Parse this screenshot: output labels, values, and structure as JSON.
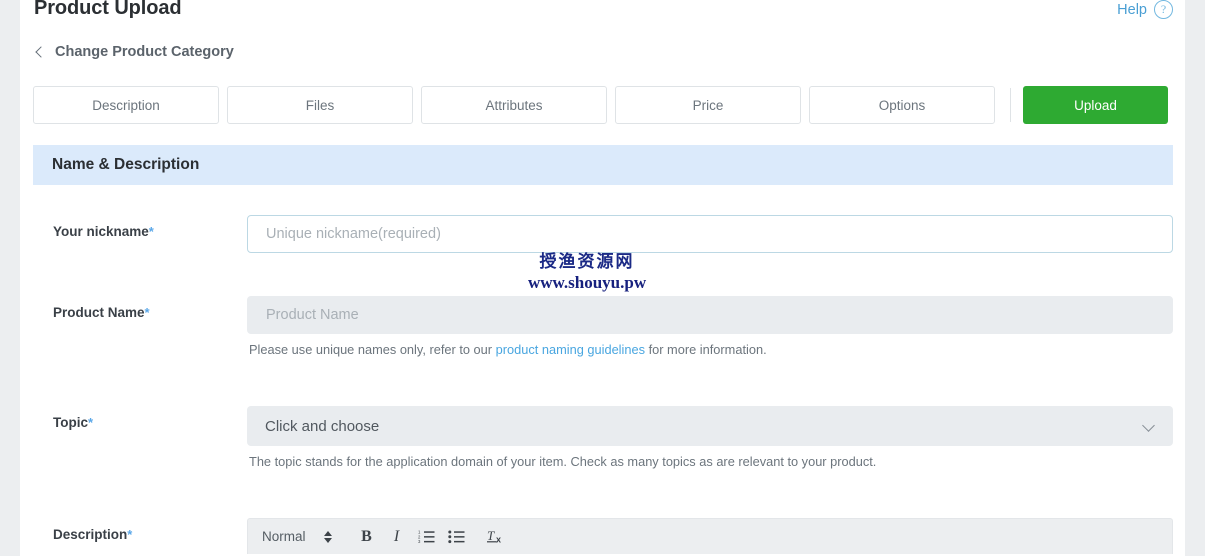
{
  "header": {
    "title": "Product Upload",
    "help_label": "Help",
    "help_icon": "question-circle-icon"
  },
  "breadcrumb": {
    "back_icon": "chevron-left-icon",
    "label": "Change Product Category"
  },
  "tabs": [
    {
      "label": "Description"
    },
    {
      "label": "Files"
    },
    {
      "label": "Attributes"
    },
    {
      "label": "Price"
    },
    {
      "label": "Options"
    }
  ],
  "upload_button": {
    "label": "Upload",
    "color": "#2eaa32"
  },
  "section": {
    "title": "Name & Description",
    "background": "#dbeafb"
  },
  "fields": {
    "nickname": {
      "label": "Your nickname",
      "required_marker": "*",
      "placeholder": "Unique nickname(required)",
      "value": ""
    },
    "product_name": {
      "label": "Product Name",
      "required_marker": "*",
      "placeholder": "Product Name",
      "value": "",
      "hint_before": "Please use unique names only, refer to our ",
      "hint_link": "product naming guidelines",
      "hint_after": " for more information."
    },
    "topic": {
      "label": "Topic",
      "required_marker": "*",
      "selected": "Click and choose",
      "dropdown_icon": "chevron-down-icon",
      "hint": "The topic stands for the application domain of your item. Check as many topics as are relevant to your product."
    },
    "description": {
      "label": "Description",
      "required_marker": "*",
      "toolbar": {
        "format_label": "Normal",
        "stepper_icon": "updown-stepper-icon",
        "bold_icon": "B",
        "italic_icon": "I",
        "ordered_list_icon": "ordered-list-icon",
        "bullet_list_icon": "bullet-list-icon",
        "clear_format_icon": "Tx"
      }
    }
  },
  "watermark": {
    "line1": "授渔资源网",
    "line2": "www.shouyu.pw"
  }
}
